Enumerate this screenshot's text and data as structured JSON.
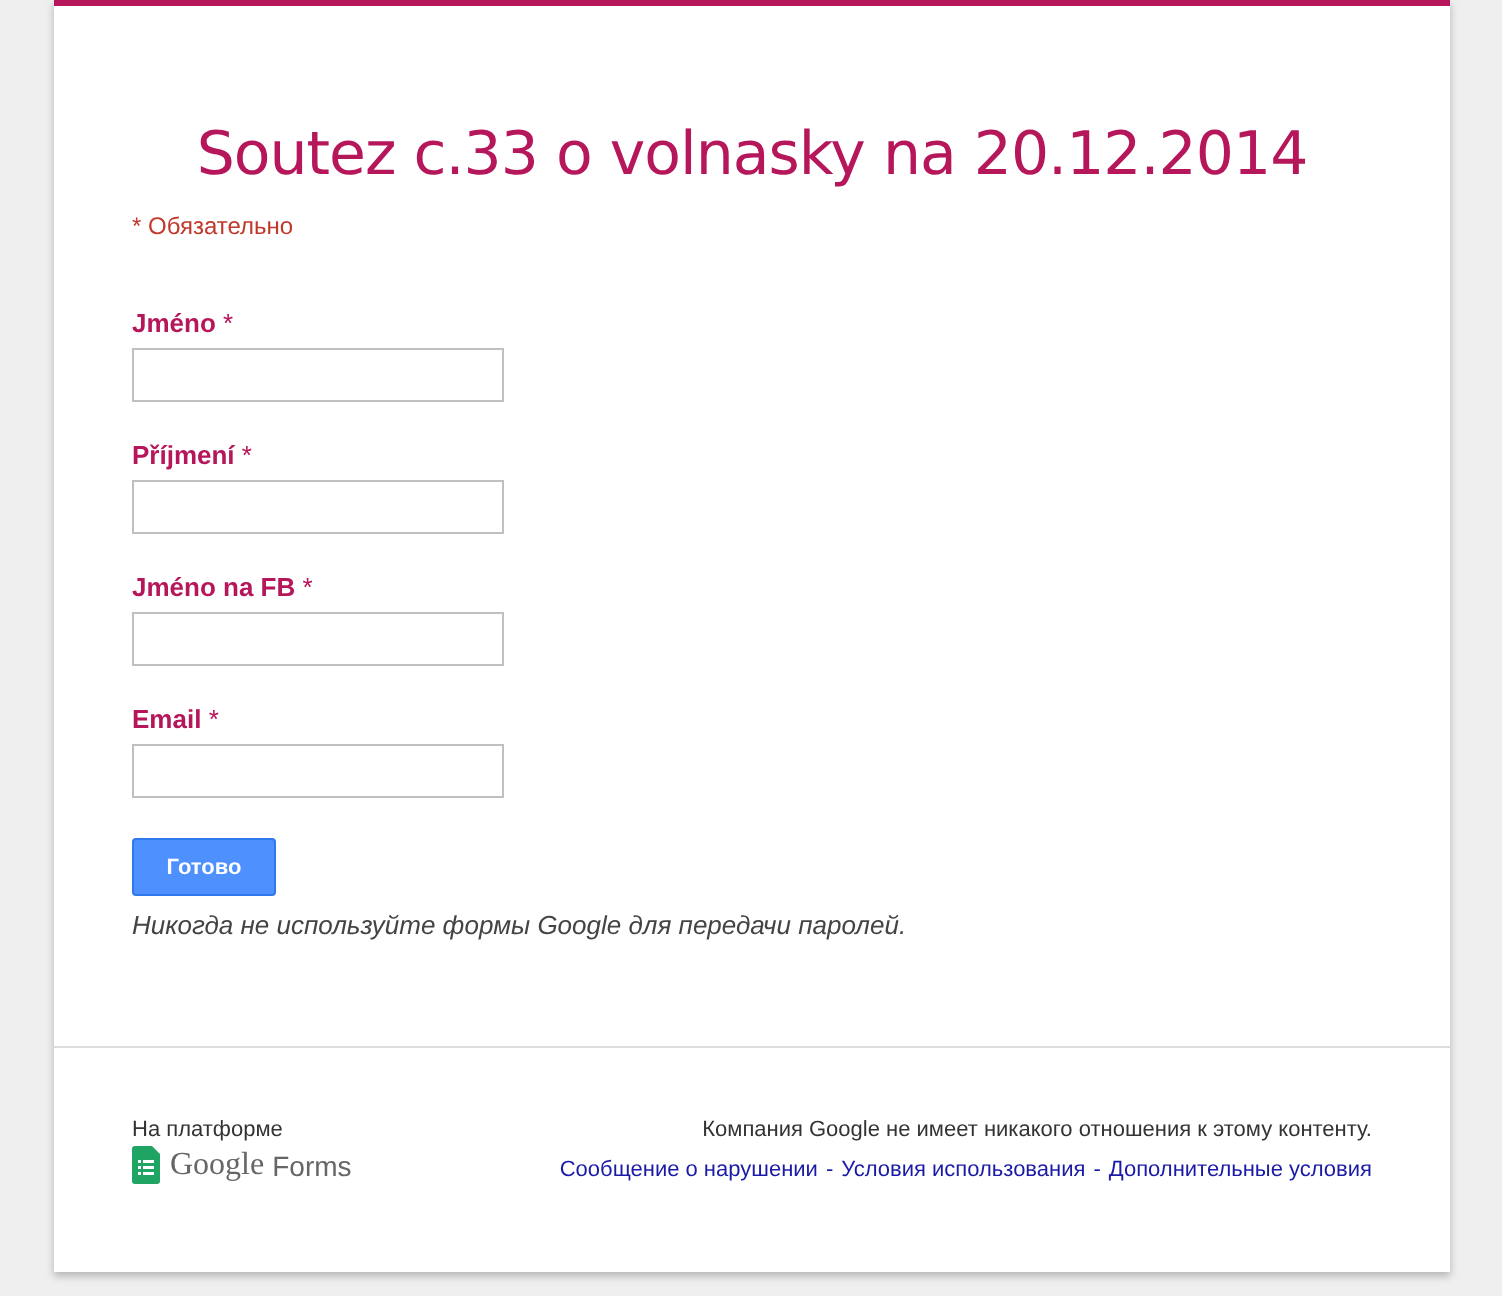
{
  "form": {
    "title": "Soutez c.33 o volnasky na 20.12.2014",
    "required_note": "* Обязательно",
    "fields": [
      {
        "label": "Jméno",
        "required_mark": "*"
      },
      {
        "label": "Příjmení",
        "required_mark": "*"
      },
      {
        "label": "Jméno na FB",
        "required_mark": "*"
      },
      {
        "label": "Email",
        "required_mark": "*"
      }
    ],
    "submit": "Готово",
    "password_warning": "Никогда не используйте формы Google для передачи паролей."
  },
  "footer": {
    "powered_by": "На платформе",
    "brand": [
      "Google",
      "Forms"
    ],
    "disclaimer": "Компания Google не имеет никакого отношения к этому контенту.",
    "separator": "-",
    "links": [
      "Сообщение о нарушении",
      "Условия использования",
      "Дополнительные условия"
    ]
  }
}
